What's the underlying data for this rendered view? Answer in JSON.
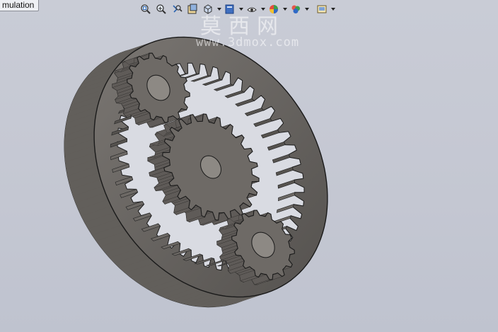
{
  "tab": {
    "label": "mulation"
  },
  "toolbar": {
    "buttons": [
      {
        "icon": "zoom-to-fit-icon"
      },
      {
        "icon": "zoom-to-area-icon"
      },
      {
        "icon": "previous-view-icon"
      },
      {
        "icon": "section-view-icon"
      },
      {
        "icon": "view-orientation-icon",
        "dropdown": true
      },
      {
        "icon": "display-style-icon",
        "dropdown": true
      },
      {
        "icon": "hide-show-items-icon",
        "dropdown": true
      },
      {
        "icon": "edit-appearance-icon",
        "dropdown": true
      },
      {
        "icon": "apply-scene-icon",
        "dropdown": true
      },
      {
        "icon": "view-settings-icon",
        "dropdown": true
      }
    ]
  },
  "watermark": {
    "title": "莫西网",
    "url": "www.3dmox.com"
  },
  "model": {
    "description_colors": {
      "metal": "#6e6a66",
      "metal_light": "#8d8984",
      "metal_dark": "#4e4b48",
      "edge": "#1a1a1a"
    }
  }
}
